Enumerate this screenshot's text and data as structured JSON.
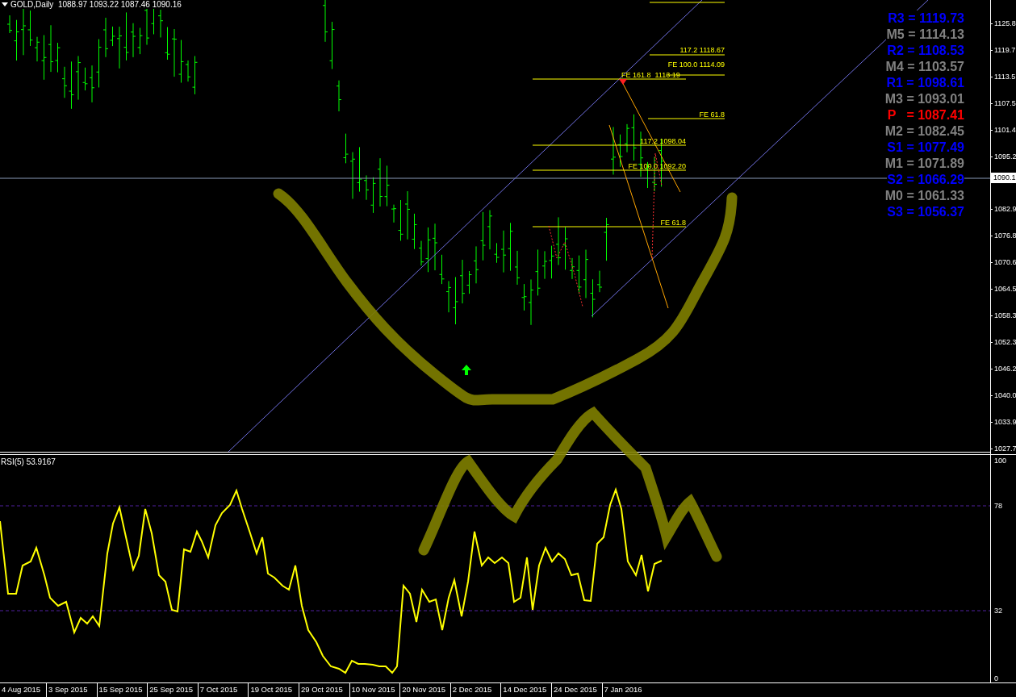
{
  "chart_title": "GOLD,Daily  1088.97 1093.22 1087.46 1090.16",
  "fibo_labels": [
    {
      "text": "117.2 1118.67"
    },
    {
      "text": "FE 100.0 1114.09"
    },
    {
      "text": "FE 161.8  1113.19"
    },
    {
      "text": "FE 61.8"
    },
    {
      "text": "117.2 1098.04"
    },
    {
      "text": "FE 100.0 1092.20"
    },
    {
      "text": "FE 61.8"
    }
  ],
  "pivot_levels": [
    {
      "text": "R3 = 1119.73",
      "color": "#0000ff"
    },
    {
      "text": "M5 = 1114.13",
      "color": "#808080"
    },
    {
      "text": "R2 = 1108.53",
      "color": "#0000ff"
    },
    {
      "text": "M4 = 1103.57",
      "color": "#808080"
    },
    {
      "text": "R1 = 1098.61",
      "color": "#0000ff"
    },
    {
      "text": "M3 = 1093.01",
      "color": "#808080"
    },
    {
      "text": "P   = 1087.41",
      "color": "#ff0000"
    },
    {
      "text": "M2 = 1082.45",
      "color": "#808080"
    },
    {
      "text": "S1 = 1077.49",
      "color": "#0000ff"
    },
    {
      "text": "M1 = 1071.89",
      "color": "#808080"
    },
    {
      "text": "S2 = 1066.29",
      "color": "#0000ff"
    },
    {
      "text": "M0 = 1061.33",
      "color": "#808080"
    },
    {
      "text": "S3 = 1056.37",
      "color": "#0000ff"
    }
  ],
  "price_axis": {
    "labels_above": [
      "1125.8",
      "1119.7",
      "1113.5",
      "1107.5",
      "1101.4",
      "1095.2"
    ],
    "current_price": "1090.1",
    "labels_below": [
      "1082.9",
      "1076.8",
      "1070.6",
      "1064.5",
      "1058.3",
      "1052.3",
      "1046.2",
      "1040.0",
      "1033.9",
      "1027.7"
    ]
  },
  "indicator": {
    "title": "RSI(5) 53.9167",
    "axis_labels": [
      "100",
      "78",
      "32",
      "0"
    ]
  },
  "time_axis": [
    "4 Aug 2015",
    "3 Sep 2015",
    "15 Sep 2015",
    "25 Sep 2015",
    "7 Oct 2015",
    "19 Oct 2015",
    "29 Oct 2015",
    "10 Nov 2015",
    "20 Nov 2015",
    "2 Dec 2015",
    "14 Dec 2015",
    "24 Dec 2015",
    "7 Jan 2016"
  ]
}
